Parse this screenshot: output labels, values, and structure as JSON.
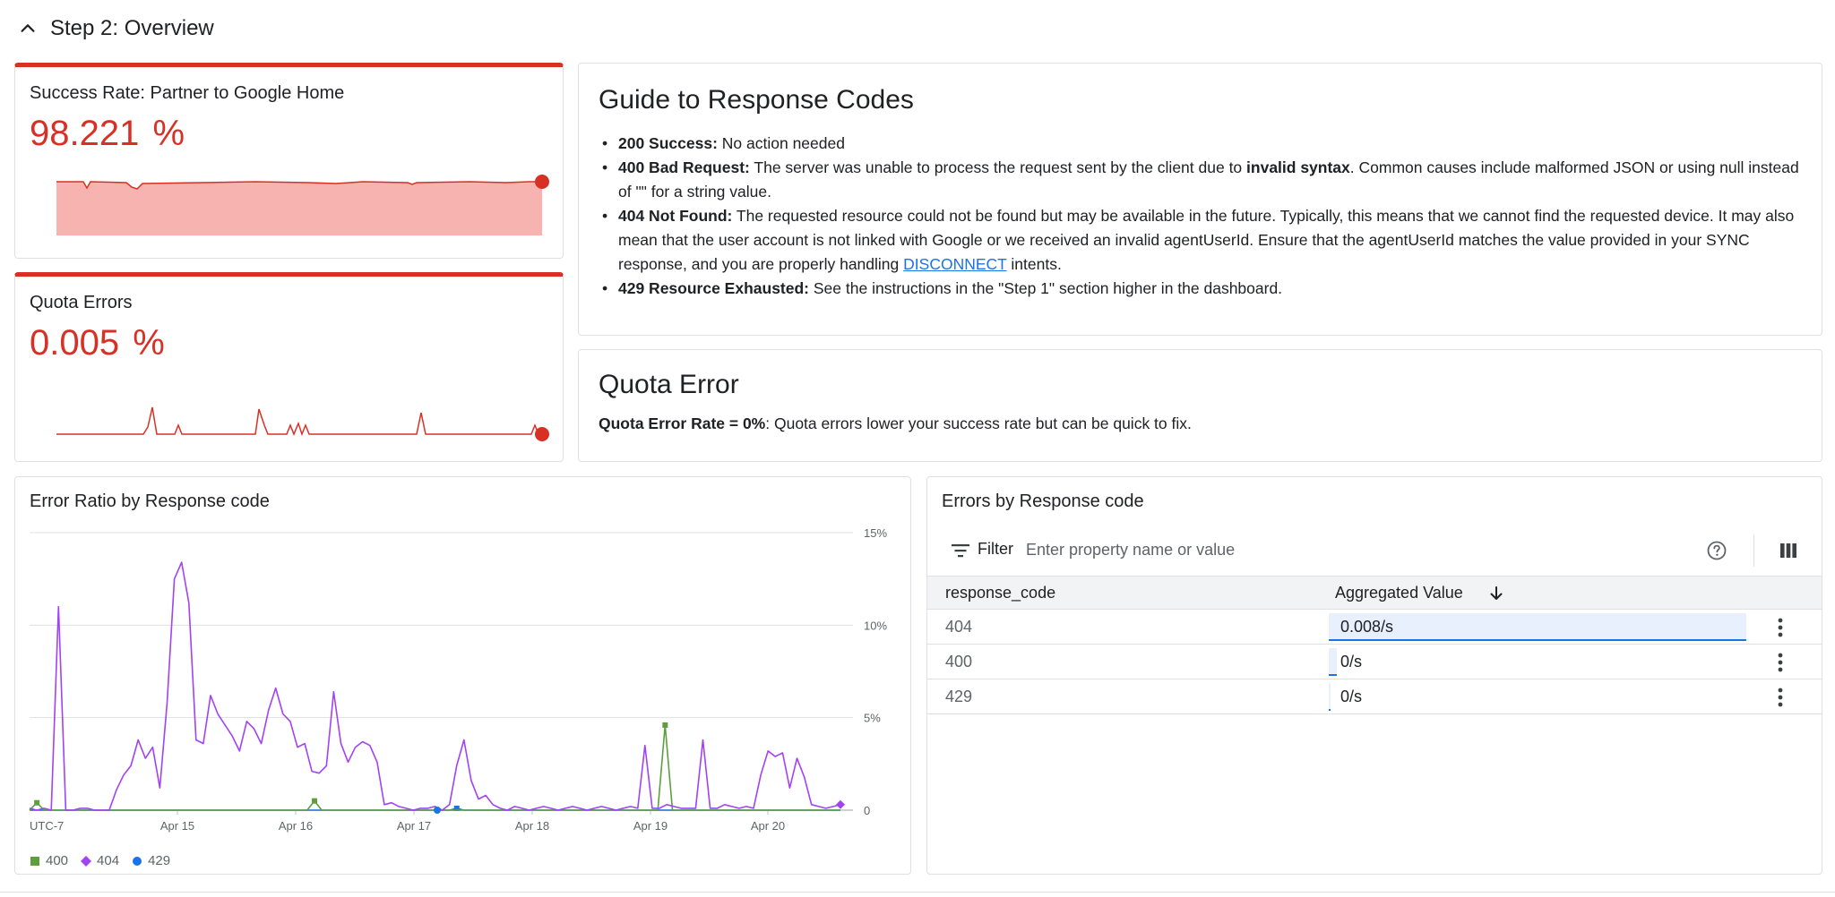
{
  "section": {
    "title": "Step 2: Overview"
  },
  "success_card": {
    "title": "Success Rate: Partner to Google Home",
    "value": "98.221",
    "unit": "%"
  },
  "quota_card": {
    "title": "Quota Errors",
    "value": "0.005",
    "unit": "%"
  },
  "guide": {
    "title": "Guide to Response Codes",
    "items": [
      {
        "label": "200 Success:",
        "text": " No action needed"
      },
      {
        "label": "400 Bad Request:",
        "text_before": " The server was unable to process the request sent by the client due to ",
        "emphasis": "invalid syntax",
        "text_after": ". Common causes include malformed JSON or using null instead of \"\" for a string value."
      },
      {
        "label": "404 Not Found:",
        "text_before": " The requested resource could not be found but may be available in the future. Typically, this means that we cannot find the requested device. It may also mean that the user account is not linked with Google or we received an invalid agentUserId. Ensure that the agentUserId matches the value provided in your SYNC response, and you are properly handling ",
        "link": "DISCONNECT",
        "text_after": " intents."
      },
      {
        "label": "429 Resource Exhausted:",
        "text": " See the instructions in the \"Step 1\" section higher in the dashboard."
      }
    ]
  },
  "quota_error": {
    "title": "Quota Error",
    "label": "Quota Error Rate = 0%",
    "text": ": Quota errors lower your success rate but can be quick to fix."
  },
  "error_ratio": {
    "title": "Error Ratio by Response code",
    "chart_data": {
      "type": "line",
      "title": "Error Ratio by Response code",
      "ylim": [
        0,
        15
      ],
      "yticks": [
        "15%",
        "10%",
        "5%",
        "0"
      ],
      "xticks": [
        "UTC-7",
        "Apr 15",
        "Apr 16",
        "Apr 17",
        "Apr 18",
        "Apr 19",
        "Apr 20"
      ],
      "grid": true,
      "legend_position": "bottom-left",
      "series": [
        {
          "name": "400",
          "color": "#5e9e3e",
          "values": [
            0,
            0.4,
            0,
            0,
            0,
            0,
            0,
            0,
            0,
            0,
            0,
            0,
            0,
            0,
            0,
            0,
            0,
            0,
            0,
            0,
            0,
            0,
            0,
            0,
            0,
            0,
            0,
            0,
            0,
            0,
            0,
            0,
            0,
            0,
            0,
            0,
            0,
            0,
            0,
            0.5,
            0,
            0,
            0,
            0,
            0,
            0,
            0,
            0,
            0,
            0,
            0,
            0,
            0,
            0,
            0,
            0,
            0,
            0,
            0,
            0,
            0,
            0,
            0,
            0,
            0,
            0,
            0,
            0,
            0,
            0,
            0,
            0,
            0,
            0,
            0,
            0,
            0,
            0,
            0,
            0,
            0,
            0,
            0,
            0,
            0,
            0,
            0,
            4.6,
            0,
            0,
            0,
            0,
            0,
            0,
            0,
            0,
            0,
            0,
            0,
            0,
            0,
            0,
            0,
            0,
            0,
            0,
            0,
            0,
            0,
            0,
            0,
            0
          ]
        },
        {
          "name": "404",
          "color": "#a142f4",
          "values": [
            0.1,
            0,
            0.1,
            0,
            11,
            0,
            0,
            0.1,
            0.1,
            0,
            0,
            0,
            1.1,
            1.9,
            2.4,
            3.8,
            2.8,
            3.4,
            1.2,
            5.8,
            12.5,
            13.4,
            11.2,
            3.8,
            3.6,
            6.2,
            5.2,
            4.6,
            4.0,
            3.2,
            4.8,
            4.4,
            3.6,
            5.4,
            6.6,
            5.2,
            4.8,
            3.4,
            3.6,
            2.1,
            2.0,
            2.4,
            6.4,
            3.6,
            2.6,
            3.4,
            3.7,
            3.5,
            2.6,
            0.3,
            0.4,
            0.2,
            0.1,
            0,
            0.1,
            0.1,
            0.2,
            0,
            0.3,
            2.4,
            3.8,
            1.6,
            0.6,
            0.8,
            0.3,
            0.1,
            0,
            0.2,
            0.1,
            0,
            0.1,
            0.2,
            0.1,
            0,
            0.1,
            0.2,
            0.1,
            0,
            0.1,
            0.2,
            0.1,
            0,
            0.1,
            0.2,
            0.1,
            3.5,
            0.1,
            0.1,
            0.3,
            0.2,
            0.1,
            0.1,
            0.1,
            3.8,
            0.1,
            0.1,
            0.3,
            0.2,
            0.1,
            0.2,
            0.1,
            1.9,
            3.2,
            2.9,
            3.1,
            1.2,
            2.8,
            1.8,
            0.3,
            0.2,
            0.1,
            0.2,
            0.3
          ]
        },
        {
          "name": "429",
          "color": "#1a73e8",
          "values": [
            0,
            0,
            0,
            0,
            0,
            0,
            0,
            0,
            0,
            0,
            0,
            0,
            0,
            0,
            0,
            0,
            0,
            0,
            0,
            0,
            0,
            0,
            0,
            0,
            0,
            0,
            0,
            0,
            0,
            0,
            0,
            0,
            0,
            0,
            0,
            0,
            0,
            0,
            0,
            0,
            0,
            0,
            0,
            0,
            0,
            0,
            0,
            0,
            0,
            0,
            0,
            0,
            0,
            0,
            0,
            0,
            0,
            0,
            0,
            0.1,
            0,
            0,
            0,
            0,
            0,
            0,
            0,
            0,
            0,
            0,
            0,
            0,
            0,
            0,
            0,
            0,
            0,
            0,
            0,
            0,
            0,
            0,
            0,
            0,
            0,
            0,
            0,
            0,
            0,
            0,
            0,
            0,
            0,
            0,
            0,
            0,
            0,
            0,
            0,
            0,
            0,
            0,
            0,
            0,
            0,
            0,
            0,
            0,
            0,
            0,
            0,
            0,
            0
          ]
        }
      ]
    }
  },
  "errors_table": {
    "title": "Errors by Response code",
    "filter_label": "Filter",
    "filter_placeholder": "Enter property name or value",
    "columns": [
      "response_code",
      "Aggregated Value"
    ],
    "rows": [
      {
        "code": "404",
        "value": "0.008/s",
        "fraction": 1.0
      },
      {
        "code": "400",
        "value": "0/s",
        "fraction": 0.02
      },
      {
        "code": "429",
        "value": "0/s",
        "fraction": 0.005
      }
    ]
  },
  "icons": {
    "section_toggle": "chevron-up-icon",
    "filter": "filter-icon",
    "help": "help-icon",
    "columns": "columns-icon",
    "sort": "arrow-down-icon",
    "row_menu": "more-vert-icon"
  },
  "colors": {
    "accent_red": "#d93025",
    "spark_fill": "#f6b3b0",
    "link_blue": "#1a73e8",
    "series_400": "#5e9e3e",
    "series_404": "#a142f4",
    "series_429": "#1a73e8"
  }
}
